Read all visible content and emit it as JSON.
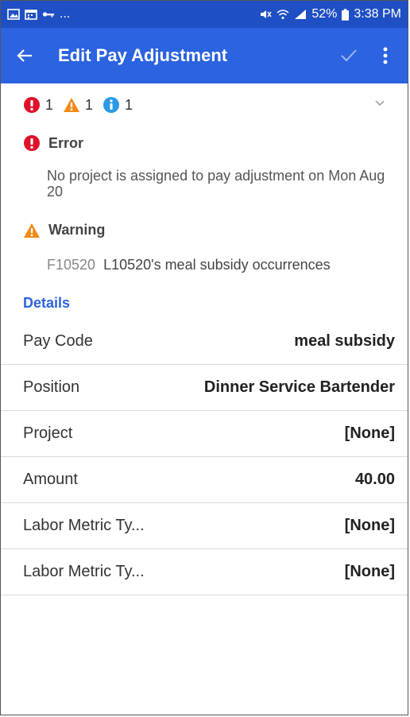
{
  "status_bar": {
    "left_indicator": "...",
    "battery": "52%",
    "time": "3:38 PM",
    "icons": [
      "image-icon",
      "calendar-icon",
      "key-icon",
      "mute-icon",
      "wifi-icon",
      "signal-icon",
      "battery-icon"
    ]
  },
  "app_bar": {
    "title": "Edit Pay Adjustment",
    "icons": [
      "back-arrow-icon",
      "check-icon",
      "more-vert-icon"
    ]
  },
  "summary": {
    "error_count": "1",
    "warning_count": "1",
    "info_count": "1"
  },
  "error": {
    "label": "Error",
    "message": "No project is assigned to pay adjustment on Mon Aug 20"
  },
  "warning": {
    "label": "Warning",
    "code": "F10520",
    "message": "L10520's meal subsidy occurrences"
  },
  "details": {
    "heading": "Details",
    "rows": [
      {
        "label": "Pay Code",
        "value": "meal subsidy"
      },
      {
        "label": "Position",
        "value": "Dinner Service Bartender"
      },
      {
        "label": "Project",
        "value": "[None]"
      },
      {
        "label": "Amount",
        "value": "40.00"
      },
      {
        "label": "Labor Metric Ty...",
        "value": "[None]"
      },
      {
        "label": "Labor Metric Ty...",
        "value": "[None]"
      }
    ]
  },
  "colors": {
    "status_bar": "#1f4fc4",
    "app_bar": "#2b63e0",
    "error": "#e0102a",
    "warning": "#f28a16",
    "info": "#2a9ae8",
    "accent": "#2b63e0"
  }
}
